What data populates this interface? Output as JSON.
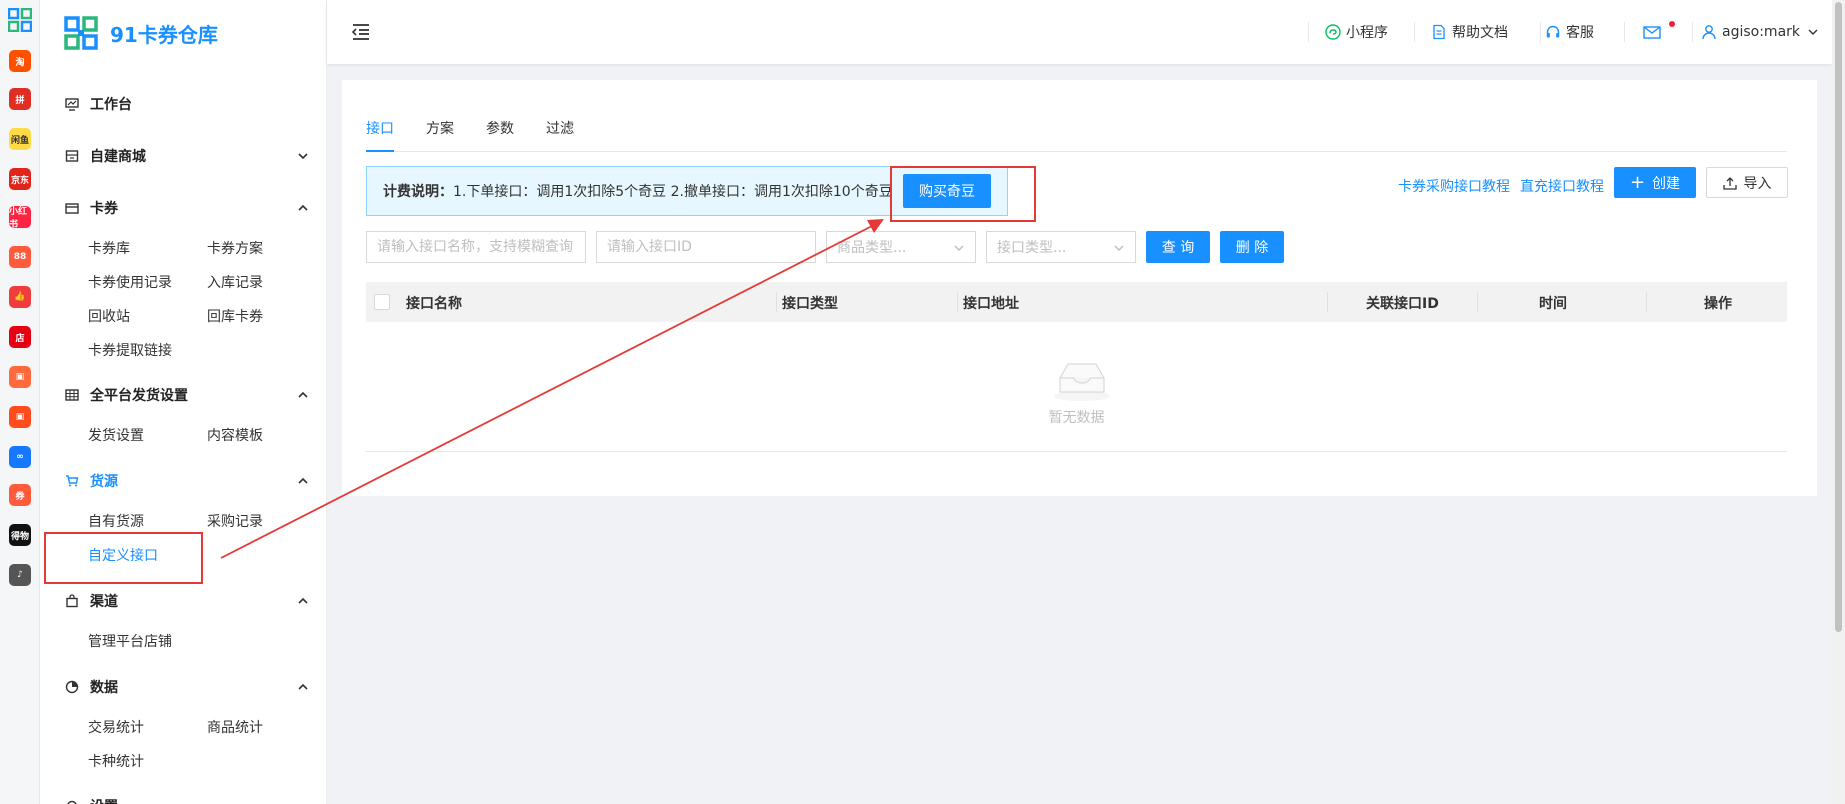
{
  "brand": {
    "name": "91卡券仓库"
  },
  "rail": {
    "platforms": [
      {
        "icon": "taobao-icon",
        "label": "淘",
        "color": "#ff5000"
      },
      {
        "icon": "pinduoduo-icon",
        "label": "拼",
        "color": "#e02e24"
      },
      {
        "icon": "xianyu-icon",
        "label": "闲鱼",
        "color": "#ffda44"
      },
      {
        "icon": "jd-icon",
        "label": "京东",
        "color": "#e1251b"
      },
      {
        "icon": "xiaohongshu-icon",
        "label": "小红书",
        "color": "#ff2442"
      },
      {
        "icon": "meituan-icon",
        "label": "88",
        "color": "#ff5a3c"
      },
      {
        "icon": "thumbs-up-icon",
        "label": "👍",
        "color": "#f03c3c"
      },
      {
        "icon": "dian-icon",
        "label": "店",
        "color": "#e60012"
      },
      {
        "icon": "shop-bag-icon",
        "label": "▣",
        "color": "#ff6a3d"
      },
      {
        "icon": "youzan-icon",
        "label": "▣",
        "color": "#ff4c1f"
      },
      {
        "icon": "link-icon",
        "label": "∞",
        "color": "#1677ff"
      },
      {
        "icon": "coupon-icon",
        "label": "券",
        "color": "#ff5b3a"
      },
      {
        "icon": "dewu-icon",
        "label": "得物",
        "color": "#111111"
      },
      {
        "icon": "douyin-icon",
        "label": "♪",
        "color": "#555555"
      }
    ]
  },
  "sidebar": {
    "workbench": "工作台",
    "groups": [
      {
        "label": "自建商城",
        "icon": "store-icon"
      },
      {
        "label": "卡券",
        "icon": "card-icon",
        "items": [
          "卡券库",
          "卡券方案",
          "卡券使用记录",
          "入库记录",
          "回收站",
          "回库卡券",
          "卡券提取链接"
        ]
      },
      {
        "label": "全平台发货设置",
        "icon": "grid-icon",
        "items": [
          "发货设置",
          "内容模板"
        ]
      },
      {
        "label": "货源",
        "icon": "cart-icon",
        "items": [
          "自有货源",
          "采购记录",
          "自定义接口"
        ]
      },
      {
        "label": "渠道",
        "icon": "bag-icon",
        "items": [
          "管理平台店铺"
        ]
      },
      {
        "label": "数据",
        "icon": "pie-icon",
        "items": [
          "交易统计",
          "商品统计",
          "卡种统计"
        ]
      },
      {
        "label": "设置",
        "icon": "gear-icon"
      }
    ]
  },
  "header": {
    "mini_program": "小程序",
    "help_docs": "帮助文档",
    "support": "客服",
    "user": "agiso:mark"
  },
  "main": {
    "tabs": [
      "接口",
      "方案",
      "参数",
      "过滤"
    ],
    "active_tab": "接口",
    "notice": {
      "label": "计费说明：",
      "text": "1.下单接口：调用1次扣除5个奇豆  2.撤单接口：调用1次扣除10个奇豆"
    },
    "buy_button": "购买奇豆",
    "links": [
      "卡券采购接口教程",
      "直充接口教程"
    ],
    "create_button": "创建",
    "import_button": "导入",
    "filters": {
      "name_placeholder": "请输入接口名称，支持模糊查询",
      "id_placeholder": "请输入接口ID",
      "goods_type_placeholder": "商品类型...",
      "api_type_placeholder": "接口类型..."
    },
    "query_button": "查 询",
    "delete_button": "删 除",
    "table": {
      "columns": [
        "接口名称",
        "接口类型",
        "接口地址",
        "关联接口ID",
        "时间",
        "操作"
      ],
      "empty_text": "暂无数据"
    }
  },
  "colors": {
    "accent": "#1890ff",
    "annotation": "#e53935"
  }
}
